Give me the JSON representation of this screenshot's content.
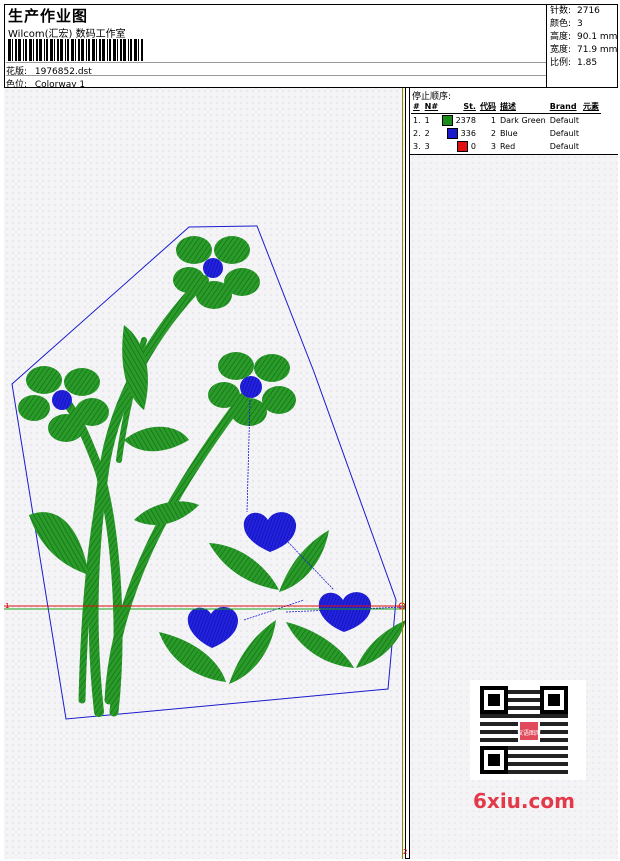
{
  "header": {
    "title": "生产作业图",
    "studio": "Wilcom(汇宏) 数码工作室",
    "design_label": "花版:",
    "design_value": "1976852.dst",
    "colorway_label": "色位:",
    "colorway_value": "Colorway 1"
  },
  "stats": [
    {
      "label": "针数:",
      "value": "2716"
    },
    {
      "label": "颜色:",
      "value": "3"
    },
    {
      "label": "高度:",
      "value": "90.1 mm"
    },
    {
      "label": "宽度:",
      "value": "71.9 mm"
    },
    {
      "label": "比例:",
      "value": "1.85"
    }
  ],
  "stop_sequence": {
    "label": "停止顺序:",
    "columns": [
      "#",
      "N#",
      "St.",
      "代码",
      "描述",
      "Brand",
      "元素"
    ],
    "rows": [
      {
        "idx": "1.",
        "n": "1",
        "color": "#1a8c1a",
        "stitches": "2378",
        "code": "1",
        "desc": "Dark Green",
        "brand": "Default",
        "elements": ""
      },
      {
        "idx": "2.",
        "n": "2",
        "color": "#1a1acc",
        "stitches": "336",
        "code": "2",
        "desc": "Blue",
        "brand": "Default",
        "elements": ""
      },
      {
        "idx": "3.",
        "n": "3",
        "color": "#e01010",
        "stitches": "0",
        "code": "3",
        "desc": "Red",
        "brand": "Default",
        "elements": ""
      }
    ]
  },
  "colors": {
    "green": "#1f8f1f",
    "blue": "#1414d8",
    "outline": "#1a1acc",
    "crosshair_red": "#e01010",
    "crosshair_green": "#18a018",
    "panel_line": "#8a8a00"
  },
  "watermark": {
    "qr_text": "汉语图库",
    "site": "6xiu.com"
  },
  "markers": {
    "left": "1",
    "bottom": "2"
  }
}
